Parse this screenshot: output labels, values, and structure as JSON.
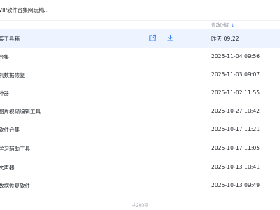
{
  "search": {
    "text": "VIP软件合集网玩精..."
  },
  "columns": {
    "modified": "修改时间",
    "sort_icon": "arrow-down-icon"
  },
  "files": [
    {
      "name": "装工具箱",
      "time": "昨天  09:22"
    },
    {
      "name": "合集",
      "time": "2025-11-04  09:56"
    },
    {
      "name": "机数据恢复",
      "time": "2025-11-03  09:07"
    },
    {
      "name": "神器",
      "time": "2025-11-02  11:55"
    },
    {
      "name": "图片视频编辑工具",
      "time": "2025-10-27  10:42"
    },
    {
      "name": "软件合集",
      "time": "2025-10-17  11:21"
    },
    {
      "name": "学习辅助工具",
      "time": "2025-10-17  11:05"
    },
    {
      "name": "文声器",
      "time": "2025-10-13  10:41"
    },
    {
      "name": "数据恢复软件",
      "time": "2025-10-13  09:49"
    }
  ],
  "row_actions": {
    "share_icon": "share-icon",
    "download_icon": "download-icon"
  },
  "footer": {
    "text": "共200项"
  },
  "colors": {
    "accent": "#3b82f6",
    "selected_bg": "#eef4ff"
  }
}
